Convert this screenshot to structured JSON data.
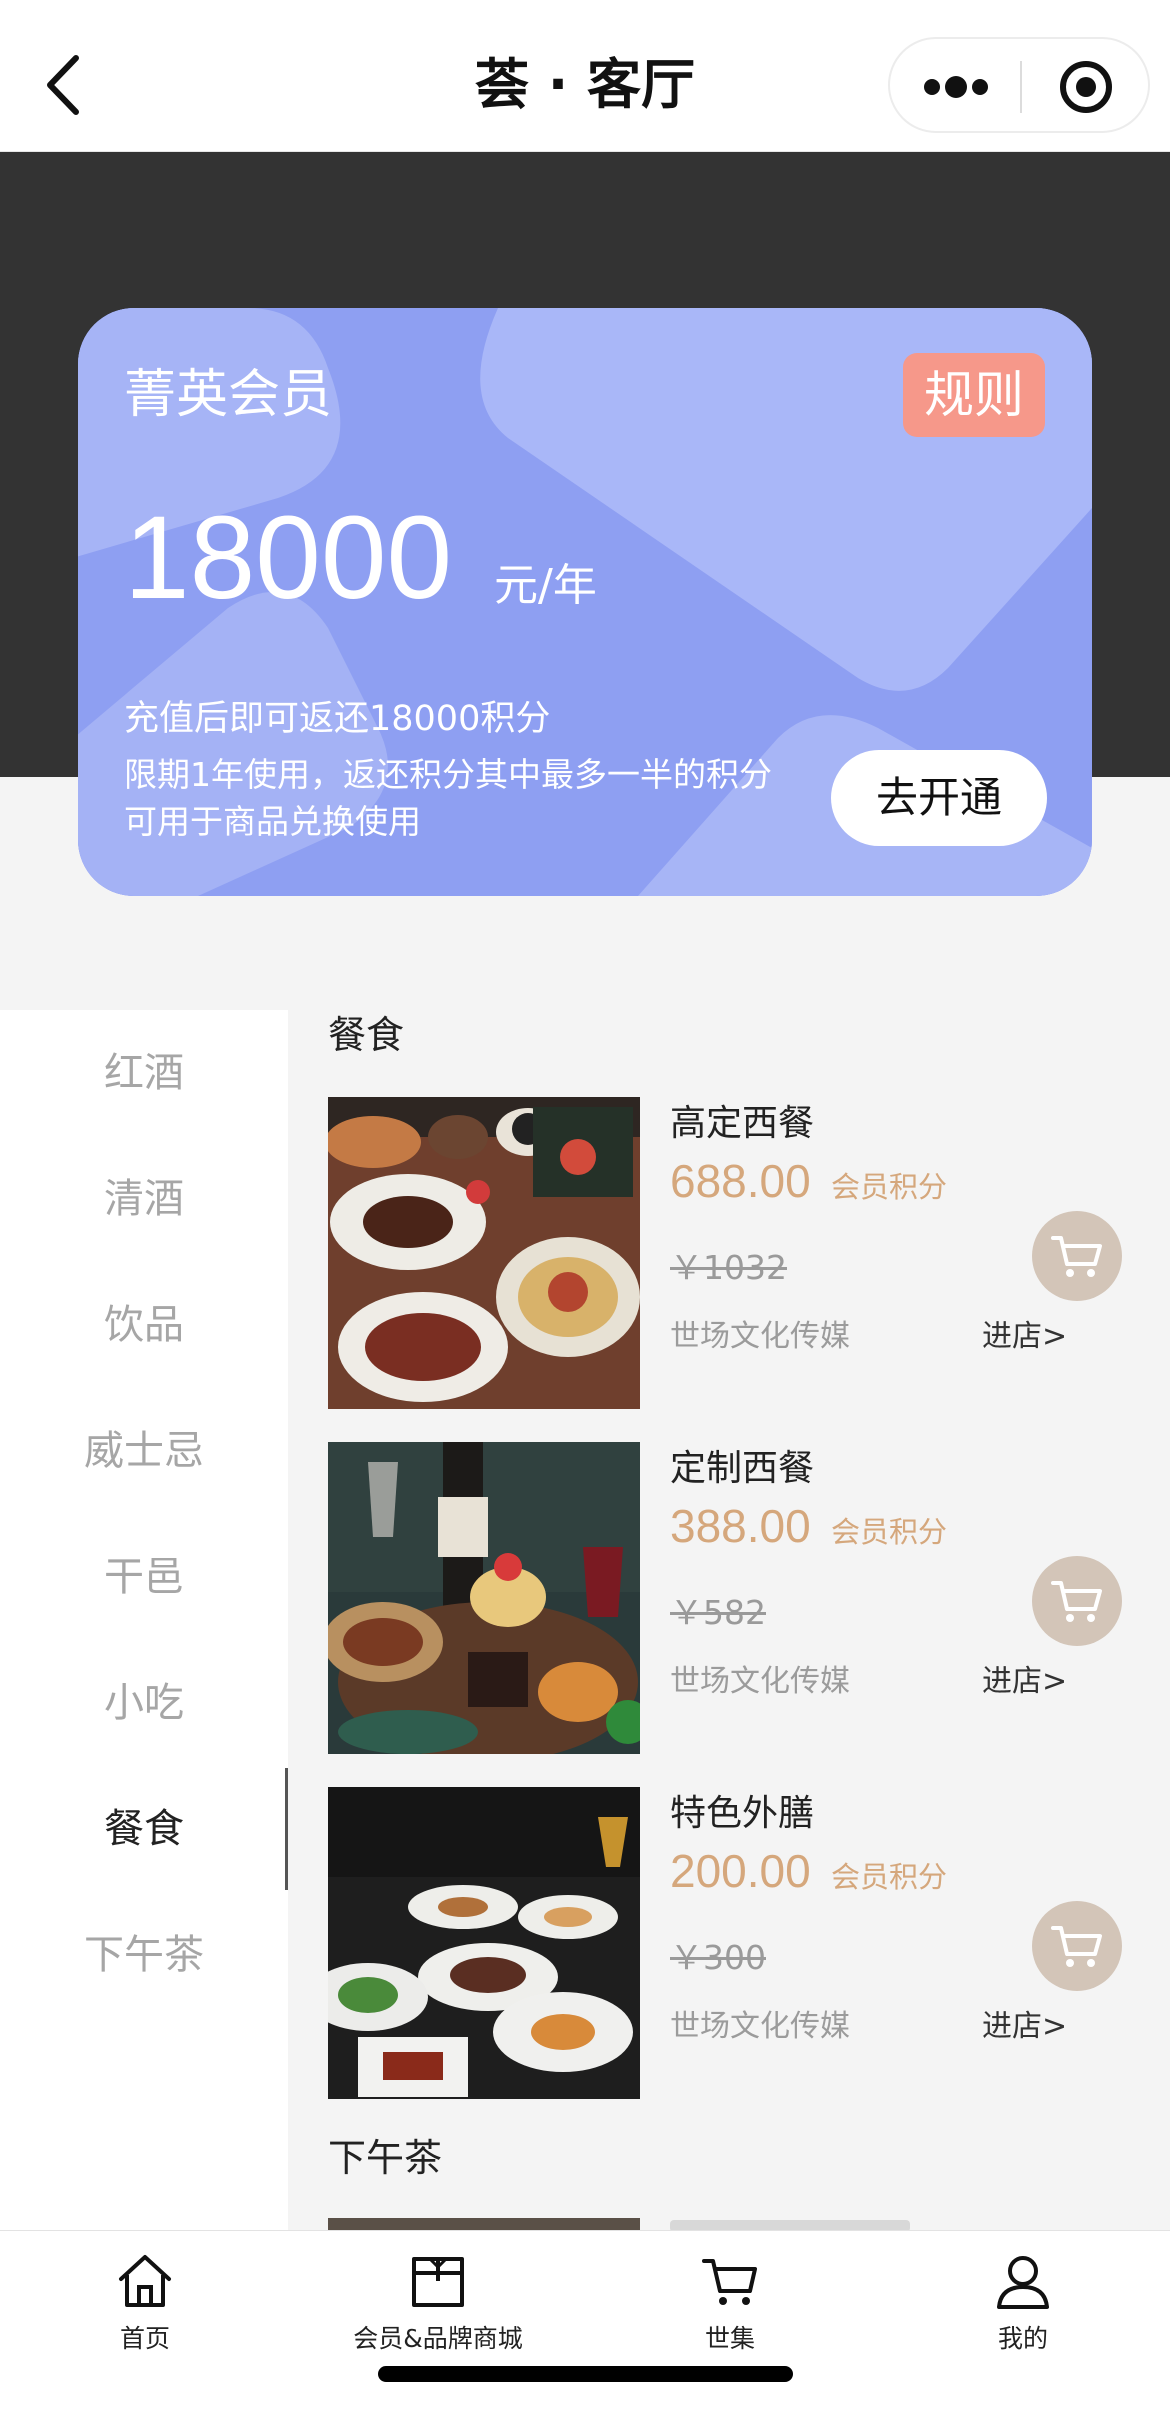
{
  "nav": {
    "title": "荟 · 客厅",
    "back_icon": "chevron-left-icon",
    "more_icon": "more-dots-icon",
    "target_icon": "target-icon"
  },
  "member_card": {
    "tier": "菁英会员",
    "rule_button": "规则",
    "price": "18000",
    "unit": "元/年",
    "desc_line1": "充值后即可返还18000积分",
    "desc_line2": "限期1年使用，返还积分其中最多一半的积分",
    "desc_line3": "可用于商品兑换使用",
    "open_button": "去开通",
    "colors": {
      "card": "#8e9ff2",
      "rule": "#f6988a"
    }
  },
  "categories": [
    {
      "label": "红酒",
      "active": false
    },
    {
      "label": "清酒",
      "active": false
    },
    {
      "label": "饮品",
      "active": false
    },
    {
      "label": "威士忌",
      "active": false
    },
    {
      "label": "干邑",
      "active": false
    },
    {
      "label": "小吃",
      "active": false
    },
    {
      "label": "餐食",
      "active": true
    },
    {
      "label": "下午茶",
      "active": false
    }
  ],
  "sections": [
    {
      "title": "餐食",
      "products": [
        {
          "name": "高定西餐",
          "points": "688.00",
          "points_label": "会员积分",
          "original_price": "￥1032",
          "merchant": "世场文化传媒",
          "store_link": "进店>",
          "cart_icon": "cart-icon"
        },
        {
          "name": "定制西餐",
          "points": "388.00",
          "points_label": "会员积分",
          "original_price": "￥582",
          "merchant": "世场文化传媒",
          "store_link": "进店>",
          "cart_icon": "cart-icon"
        },
        {
          "name": "特色外膳",
          "points": "200.00",
          "points_label": "会员积分",
          "original_price": "￥300",
          "merchant": "世场文化传媒",
          "store_link": "进店>",
          "cart_icon": "cart-icon"
        }
      ]
    },
    {
      "title": "下午茶"
    }
  ],
  "tabbar": [
    {
      "label": "首页",
      "icon": "home-icon"
    },
    {
      "label": "会员&品牌商城",
      "icon": "gift-box-icon"
    },
    {
      "label": "世集",
      "icon": "cart-icon"
    },
    {
      "label": "我的",
      "icon": "user-icon"
    }
  ],
  "accent": {
    "points": "#d5a77c",
    "cart_button": "#d3c5b8"
  }
}
